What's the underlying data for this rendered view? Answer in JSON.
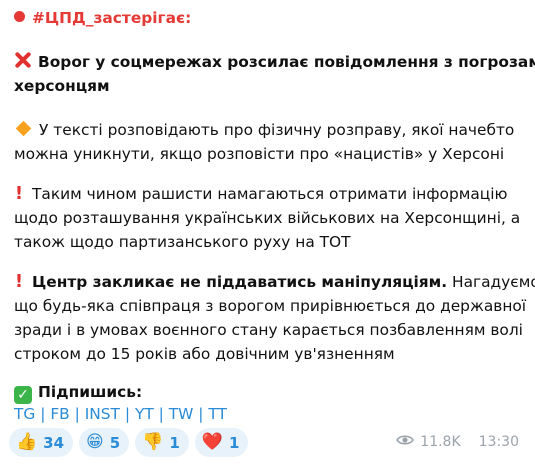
{
  "channel_tag": "#ЦПД_застерігає:",
  "headline_line1": "Ворог у соцмережах розсилає повідомлення з погрозами",
  "headline_line2": "херсонцям",
  "p1_line1": "У тексті розповідають про фізичну розправу, якої начебто",
  "p1_line2": "можна уникнути, якщо розповісти про «нацистів» у Херсоні",
  "p2_line1": "Таким чином рашисти намагаються отримати інформацію",
  "p2_line2": "щодо розташування українських військових на Херсонщині, а",
  "p2_line3": "також щодо партизанського руху на ТОТ",
  "p3_bold": "Центр закликає не піддаватись маніпуляціям.",
  "p3_rest": " Нагадуємо,",
  "p3_line2": "що будь-яка співпраця з ворогом прирівнюється до державної",
  "p3_line3": "зради і в умовах воєнного стану карається позбавленням волі",
  "p3_line4": "строком до 15 років або довічним ув'язненням",
  "subscribe_label": "Підпишись:",
  "links": [
    "TG",
    "FB",
    "INST",
    "YT",
    "TW",
    "TT"
  ],
  "reactions": [
    {
      "emoji": "👍",
      "count": "34"
    },
    {
      "emoji": "😁",
      "count": "5"
    },
    {
      "emoji": "👎",
      "count": "1"
    },
    {
      "emoji": "❤️",
      "count": "1"
    }
  ],
  "views": "11.8K",
  "time": "13:30",
  "colors": {
    "accent": "#2a8bd6",
    "red": "#e53935",
    "chip_bg": "#e8f2fb"
  }
}
